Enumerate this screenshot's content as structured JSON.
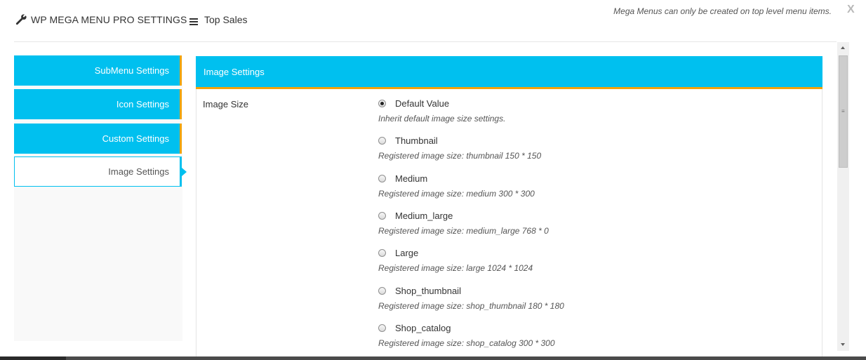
{
  "header": {
    "app_title": "WP MEGA MENU PRO SETTINGS",
    "menu_item_name": "Top Sales",
    "notice": "Mega Menus can only be created on top level menu items.",
    "close_label": "X",
    "icons": {
      "title": "wrench-icon",
      "menu": "hamburger-icon"
    }
  },
  "sidebar": {
    "tabs": [
      {
        "label": "SubMenu Settings",
        "active": false
      },
      {
        "label": "Icon Settings",
        "active": false
      },
      {
        "label": "Custom Settings",
        "active": false
      },
      {
        "label": "Image Settings",
        "active": true
      }
    ]
  },
  "panel": {
    "title": "Image Settings",
    "field_label": "Image Size",
    "selected_option": "Default Value",
    "options": [
      {
        "label": "Default Value",
        "description": "Inherit default image size settings.",
        "checked": true
      },
      {
        "label": "Thumbnail",
        "description": "Registered image size: thumbnail 150 * 150",
        "checked": false
      },
      {
        "label": "Medium",
        "description": "Registered image size: medium 300 * 300",
        "checked": false
      },
      {
        "label": "Medium_large",
        "description": "Registered image size: medium_large 768 * 0",
        "checked": false
      },
      {
        "label": "Large",
        "description": "Registered image size: large 1024 * 1024",
        "checked": false
      },
      {
        "label": "Shop_thumbnail",
        "description": "Registered image size: shop_thumbnail 180 * 180",
        "checked": false
      },
      {
        "label": "Shop_catalog",
        "description": "Registered image size: shop_catalog 300 * 300",
        "checked": false
      }
    ]
  },
  "colors": {
    "accent": "#00c0ef",
    "tab_border": "#f0a30a",
    "text": "#333333"
  }
}
